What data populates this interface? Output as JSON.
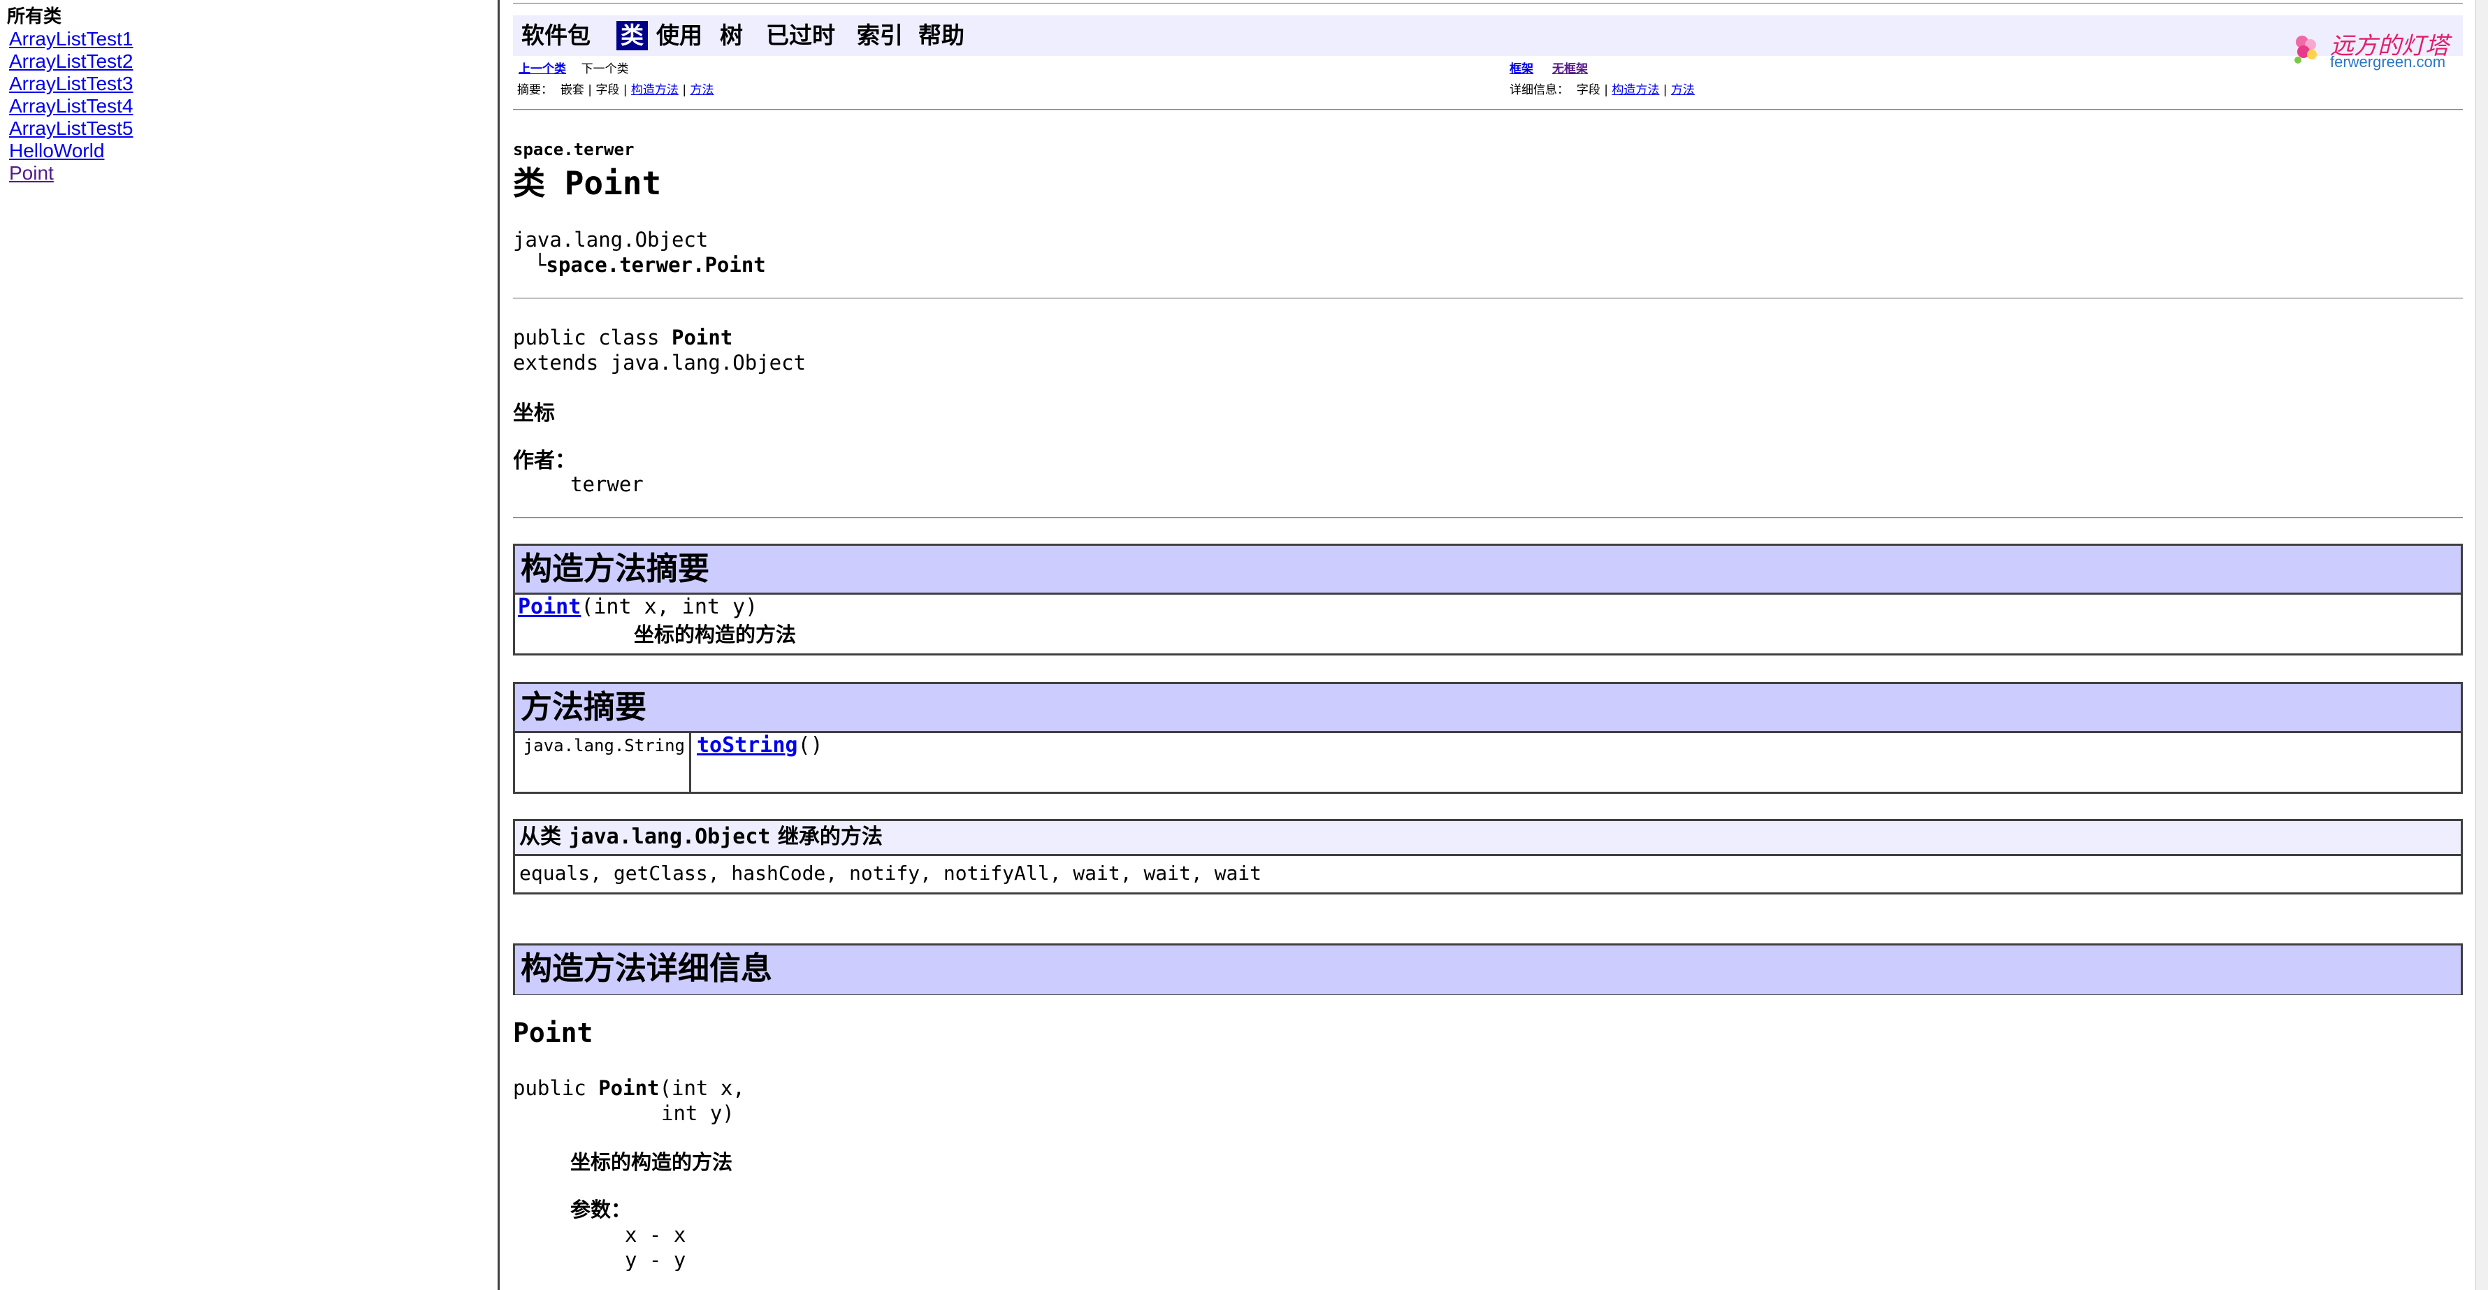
{
  "left": {
    "heading": "所有类",
    "classes": [
      "ArrayListTest1",
      "ArrayListTest2",
      "ArrayListTest3",
      "ArrayListTest4",
      "ArrayListTest5",
      "HelloWorld",
      "Point"
    ]
  },
  "nav": {
    "items": [
      "软件包",
      "类",
      "使用",
      "树",
      "已过时",
      "索引",
      "帮助"
    ],
    "active": "类"
  },
  "logo": {
    "cn": "远方的灯塔",
    "en": "ferwergreen.com"
  },
  "subnav": {
    "prev": "上一个类",
    "next": "下一个类",
    "summary_label": "摘要：",
    "summary_nested": "嵌套",
    "summary_field": "字段",
    "summary_constructor": "构造方法",
    "summary_method": "方法",
    "frames": "框架",
    "noframes": "无框架",
    "detail_label": "详细信息：",
    "detail_field": "字段",
    "detail_constructor": "构造方法",
    "detail_method": "方法",
    "sep": "|"
  },
  "classinfo": {
    "package": "space.terwer",
    "title": "类 Point",
    "tree_root": "java.lang.Object",
    "tree_child_prefix": "└",
    "tree_child": "space.terwer.Point",
    "decl_prefix": "public class ",
    "decl_name": "Point",
    "extends_line": "extends java.lang.Object",
    "description": "坐标",
    "author_label": "作者：",
    "author": "terwer"
  },
  "constructor_summary": {
    "heading": "构造方法摘要",
    "name": "Point",
    "params": "(int x, int y)",
    "description": "坐标的构造的方法"
  },
  "method_summary": {
    "heading": "方法摘要",
    "return_type": "java.lang.String",
    "name": "toString",
    "params": "()"
  },
  "inherited": {
    "heading_prefix": "从类 ",
    "heading_class": "java.lang.Object",
    "heading_suffix": " 继承的方法",
    "methods": "equals, getClass, hashCode, notify, notifyAll, wait, wait, wait"
  },
  "constructor_detail": {
    "heading": "构造方法详细信息",
    "name": "Point",
    "sig_prefix": "public ",
    "sig_name": "Point",
    "sig_line1": "(int x,",
    "sig_line2": "int y)",
    "description": "坐标的构造的方法",
    "params_label": "参数：",
    "param1": "x - x",
    "param2": "y - y"
  }
}
